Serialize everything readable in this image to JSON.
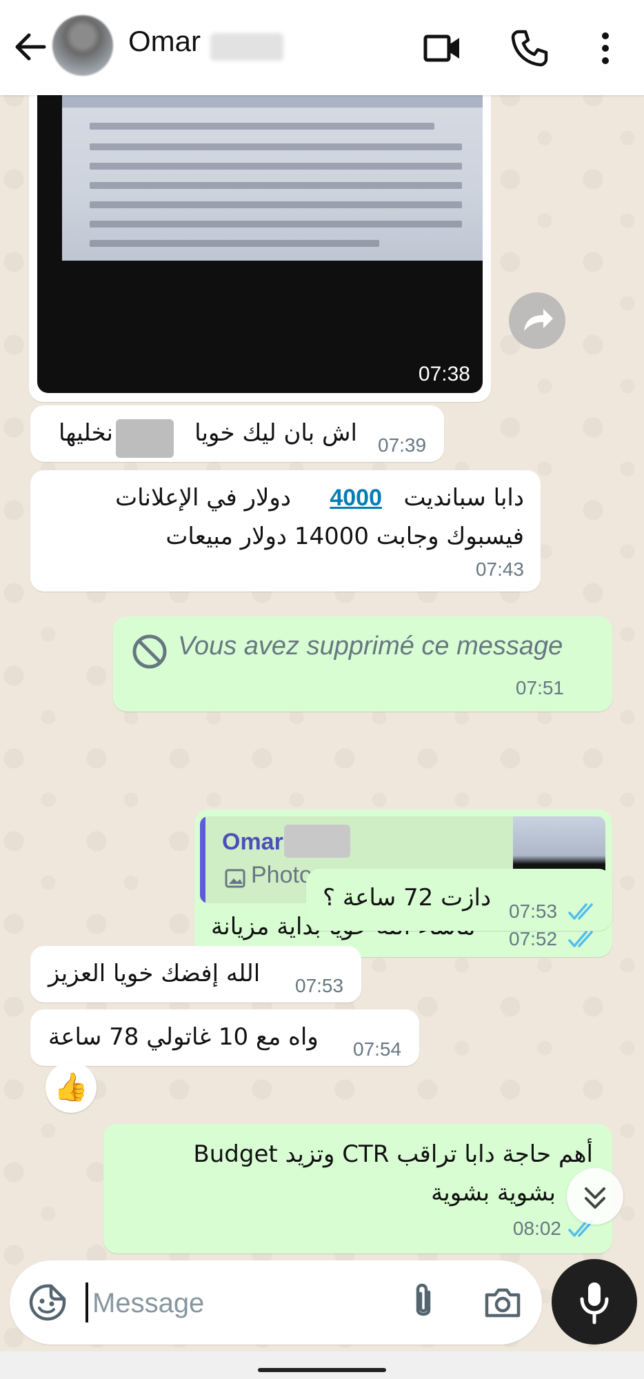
{
  "header": {
    "contact_name": "Omar",
    "icons": {
      "back": "arrow-left-icon",
      "video": "video-call-icon",
      "call": "phone-icon",
      "menu": "more-vert-icon"
    }
  },
  "messages": [
    {
      "kind": "image",
      "direction": "incoming",
      "time": "07:38"
    },
    {
      "kind": "text",
      "direction": "incoming",
      "lines": [
        "اش بان ليك خويا ▮ نخليها"
      ],
      "text_before": "اش بان ليك خويا",
      "text_after": "نخليها",
      "time": "07:39"
    },
    {
      "kind": "text",
      "direction": "incoming",
      "line1_before": "دابا سباندیت",
      "line1_link": "4000",
      "line1_after": "دولار في الإعلانات",
      "line2": "فيسبوك  وجابت 14000 دولار مبيعات",
      "time": "07:43"
    },
    {
      "kind": "deleted",
      "direction": "outgoing",
      "text": "Vous avez supprimé ce message",
      "time": "07:51"
    },
    {
      "kind": "reply",
      "direction": "outgoing",
      "quote_name": "Omar",
      "quote_type": "Photo",
      "text": "ماشاء الله خويا بداية مزيانة",
      "time": "07:52",
      "status": "read"
    },
    {
      "kind": "text",
      "direction": "outgoing",
      "text": "دازت 72 ساعة ؟",
      "time": "07:53",
      "status": "read"
    },
    {
      "kind": "text",
      "direction": "incoming",
      "text": "الله إفضك خويا العزيز",
      "time": "07:53"
    },
    {
      "kind": "text",
      "direction": "incoming",
      "text": "واه مع 10 غاتولي 78 ساعة",
      "time": "07:54",
      "reaction": "👍"
    },
    {
      "kind": "text",
      "direction": "outgoing",
      "line1": "أهم حاجة دابا تراقب CTR وتزيد Budget",
      "line2": "بشوية بشوية",
      "time": "08:02",
      "status": "read"
    }
  ],
  "composer": {
    "placeholder": "Message",
    "icons": {
      "sticker": "sticker-smiley-icon",
      "attach": "paperclip-icon",
      "camera": "camera-icon",
      "mic": "microphone-icon"
    }
  },
  "colors": {
    "outgoing_bubble": "#d9fdd3",
    "incoming_bubble": "#ffffff",
    "tick_read": "#53bdeb",
    "wallpaper": "#efe7dc",
    "link": "#027eb5"
  }
}
